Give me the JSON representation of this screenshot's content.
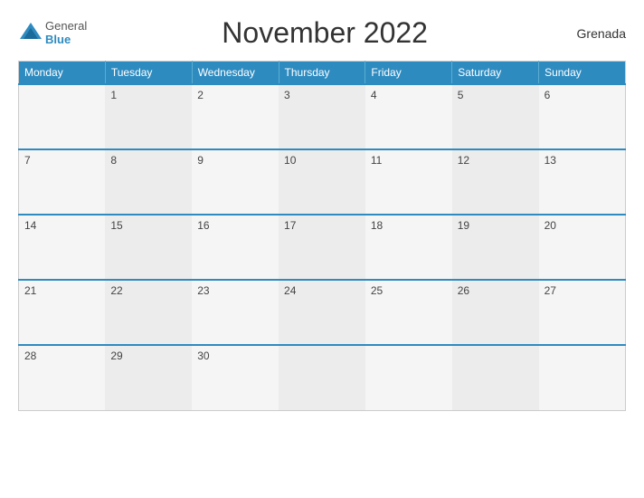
{
  "header": {
    "logo_general": "General",
    "logo_blue": "Blue",
    "title": "November 2022",
    "country": "Grenada"
  },
  "calendar": {
    "days_of_week": [
      "Monday",
      "Tuesday",
      "Wednesday",
      "Thursday",
      "Friday",
      "Saturday",
      "Sunday"
    ],
    "weeks": [
      [
        "",
        "1",
        "2",
        "3",
        "4",
        "5",
        "6"
      ],
      [
        "7",
        "8",
        "9",
        "10",
        "11",
        "12",
        "13"
      ],
      [
        "14",
        "15",
        "16",
        "17",
        "18",
        "19",
        "20"
      ],
      [
        "21",
        "22",
        "23",
        "24",
        "25",
        "26",
        "27"
      ],
      [
        "28",
        "29",
        "30",
        "",
        "",
        "",
        ""
      ]
    ]
  }
}
